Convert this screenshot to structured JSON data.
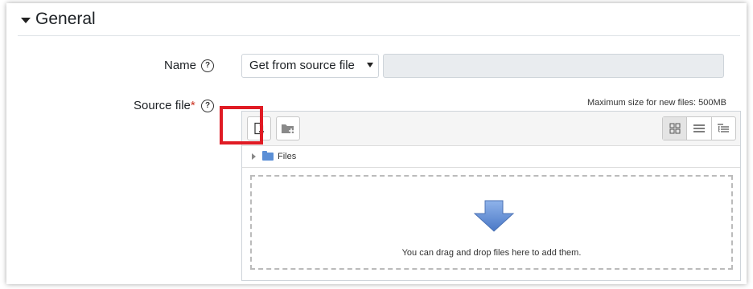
{
  "section": {
    "title": "General"
  },
  "name_field": {
    "label": "Name",
    "help_icon": "question-circle-icon",
    "select_value": "Get from source file",
    "text_value": ""
  },
  "source_file": {
    "label": "Source file",
    "required_marker": "*",
    "help_icon": "question-circle-icon",
    "max_size": "Maximum size for new files: 500MB",
    "toolbar": {
      "add_file_icon": "add-file-icon",
      "create_folder_icon": "create-folder-icon",
      "views": [
        "grid-view-icon",
        "list-view-icon",
        "tree-view-icon"
      ],
      "active_view": "grid-view-icon"
    },
    "path_label": "Files",
    "drop_text": "You can drag and drop files here to add them."
  },
  "colors": {
    "highlight": "#e01b24",
    "required": "#ca3120",
    "arrow": "#6a95d8",
    "folder": "#5b8fd6"
  }
}
